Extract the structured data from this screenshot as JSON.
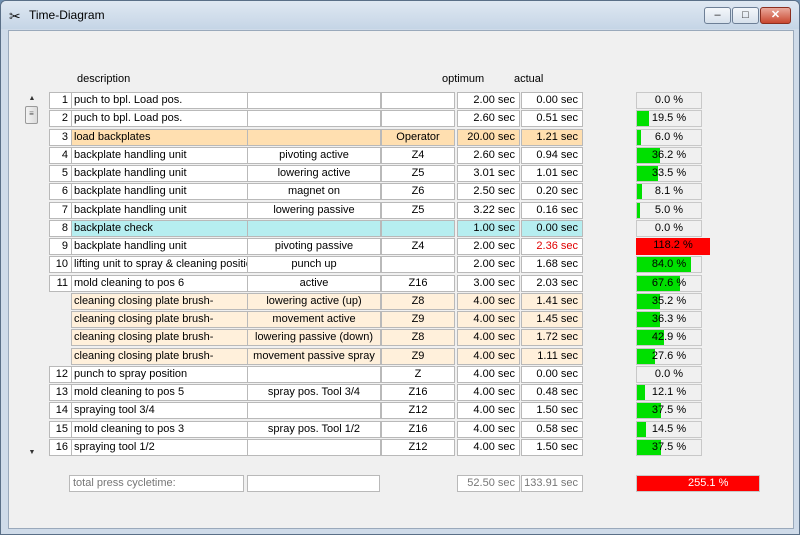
{
  "window": {
    "title": "Time-Diagram",
    "minimize": "–",
    "maximize": "□",
    "close": "✕"
  },
  "headers": {
    "description": "description",
    "optimum": "optimum",
    "actual": "actual"
  },
  "rows": [
    {
      "num": "1",
      "desc": "puch to bpl. Load pos.",
      "action": "",
      "code": "",
      "optimum": "2.00 sec",
      "actual": "0.00 sec",
      "pct": "0.0 %",
      "pct_value": 0,
      "style": "normal",
      "red": false
    },
    {
      "num": "2",
      "desc": "puch to bpl. Load pos.",
      "action": "",
      "code": "",
      "optimum": "2.60 sec",
      "actual": "0.51 sec",
      "pct": "19.5 %",
      "pct_value": 19.5,
      "style": "normal",
      "red": false
    },
    {
      "num": "3",
      "desc": "load backplates",
      "action": "",
      "code": "Operator",
      "optimum": "20.00 sec",
      "actual": "1.21 sec",
      "pct": "6.0 %",
      "pct_value": 6.0,
      "style": "orange",
      "red": false
    },
    {
      "num": "4",
      "desc": "backplate handling unit",
      "action": "pivoting active",
      "code": "Z4",
      "optimum": "2.60 sec",
      "actual": "0.94 sec",
      "pct": "36.2 %",
      "pct_value": 36.2,
      "style": "normal",
      "red": false
    },
    {
      "num": "5",
      "desc": "backplate handling unit",
      "action": "lowering active",
      "code": "Z5",
      "optimum": "3.01 sec",
      "actual": "1.01 sec",
      "pct": "33.5 %",
      "pct_value": 33.5,
      "style": "normal",
      "red": false
    },
    {
      "num": "6",
      "desc": "backplate handling unit",
      "action": "magnet on",
      "code": "Z6",
      "optimum": "2.50 sec",
      "actual": "0.20 sec",
      "pct": "8.1 %",
      "pct_value": 8.1,
      "style": "normal",
      "red": false
    },
    {
      "num": "7",
      "desc": "backplate handling unit",
      "action": "lowering passive",
      "code": "Z5",
      "optimum": "3.22 sec",
      "actual": "0.16 sec",
      "pct": "5.0 %",
      "pct_value": 5.0,
      "style": "normal",
      "red": false
    },
    {
      "num": "8",
      "desc": "backplate check",
      "action": "",
      "code": "",
      "optimum": "1.00 sec",
      "actual": "0.00 sec",
      "pct": "0.0 %",
      "pct_value": 0,
      "style": "cyan",
      "red": false
    },
    {
      "num": "9",
      "desc": "backplate handling unit",
      "action": "pivoting passive",
      "code": "Z4",
      "optimum": "2.00 sec",
      "actual": "2.36 sec",
      "pct": "118.2 %",
      "pct_value": 118.2,
      "style": "normal",
      "red": true
    },
    {
      "num": "10",
      "desc": "lifting unit to spray & cleaning position",
      "action": "punch up",
      "code": "",
      "optimum": "2.00 sec",
      "actual": "1.68 sec",
      "pct": "84.0 %",
      "pct_value": 84.0,
      "style": "normal",
      "red": false
    },
    {
      "num": "11",
      "desc": "mold cleaning to pos 6",
      "action": "active",
      "code": "Z16",
      "optimum": "3.00 sec",
      "actual": "2.03 sec",
      "pct": "67.6 %",
      "pct_value": 67.6,
      "style": "normal",
      "red": false
    },
    {
      "num": "",
      "desc": "cleaning closing plate brush-",
      "action": "lowering  active (up)",
      "code": "Z8",
      "optimum": "4.00 sec",
      "actual": "1.41 sec",
      "pct": "35.2 %",
      "pct_value": 35.2,
      "style": "lightorange",
      "red": false
    },
    {
      "num": "",
      "desc": "cleaning closing plate brush-",
      "action": "movement active",
      "code": "Z9",
      "optimum": "4.00 sec",
      "actual": "1.45 sec",
      "pct": "36.3 %",
      "pct_value": 36.3,
      "style": "lightorange",
      "red": false
    },
    {
      "num": "",
      "desc": "cleaning closing plate brush-",
      "action": "lowering  passive (down)",
      "code": "Z8",
      "optimum": "4.00 sec",
      "actual": "1.72 sec",
      "pct": "42.9 %",
      "pct_value": 42.9,
      "style": "lightorange",
      "red": false
    },
    {
      "num": "",
      "desc": "cleaning closing plate brush-",
      "action": "movement passive spray",
      "code": "Z9",
      "optimum": "4.00 sec",
      "actual": "1.11 sec",
      "pct": "27.6 %",
      "pct_value": 27.6,
      "style": "lightorange",
      "red": false
    },
    {
      "num": "12",
      "desc": "punch to spray position",
      "action": "",
      "code": "Z",
      "optimum": "4.00 sec",
      "actual": "0.00 sec",
      "pct": "0.0 %",
      "pct_value": 0,
      "style": "normal",
      "red": false
    },
    {
      "num": "13",
      "desc": "mold cleaning to pos 5",
      "action": "spray pos. Tool 3/4",
      "code": "Z16",
      "optimum": "4.00 sec",
      "actual": "0.48 sec",
      "pct": "12.1 %",
      "pct_value": 12.1,
      "style": "normal",
      "red": false
    },
    {
      "num": "14",
      "desc": "spraying tool 3/4",
      "action": "",
      "code": "Z12",
      "optimum": "4.00 sec",
      "actual": "1.50 sec",
      "pct": "37.5 %",
      "pct_value": 37.5,
      "style": "normal",
      "red": false
    },
    {
      "num": "15",
      "desc": "mold cleaning to pos 3",
      "action": "spray pos. Tool 1/2",
      "code": "Z16",
      "optimum": "4.00 sec",
      "actual": "0.58 sec",
      "pct": "14.5 %",
      "pct_value": 14.5,
      "style": "normal",
      "red": false
    },
    {
      "num": "16",
      "desc": "spraying tool 1/2",
      "action": "",
      "code": "Z12",
      "optimum": "4.00 sec",
      "actual": "1.50 sec",
      "pct": "37.5 %",
      "pct_value": 37.5,
      "style": "normal",
      "red": false
    }
  ],
  "footer": {
    "total_label": "total press cycletime:",
    "optimum_total": "52.50 sec",
    "actual_total": "133.91 sec",
    "pct": "255.1 %",
    "pct_value": 255.1
  },
  "colors": {
    "bar_green": "#00e000",
    "bar_red": "#ff0000",
    "orange_row": "#ffdfb0",
    "light_orange_row": "#fff0db",
    "cyan_row": "#b6eef0"
  }
}
